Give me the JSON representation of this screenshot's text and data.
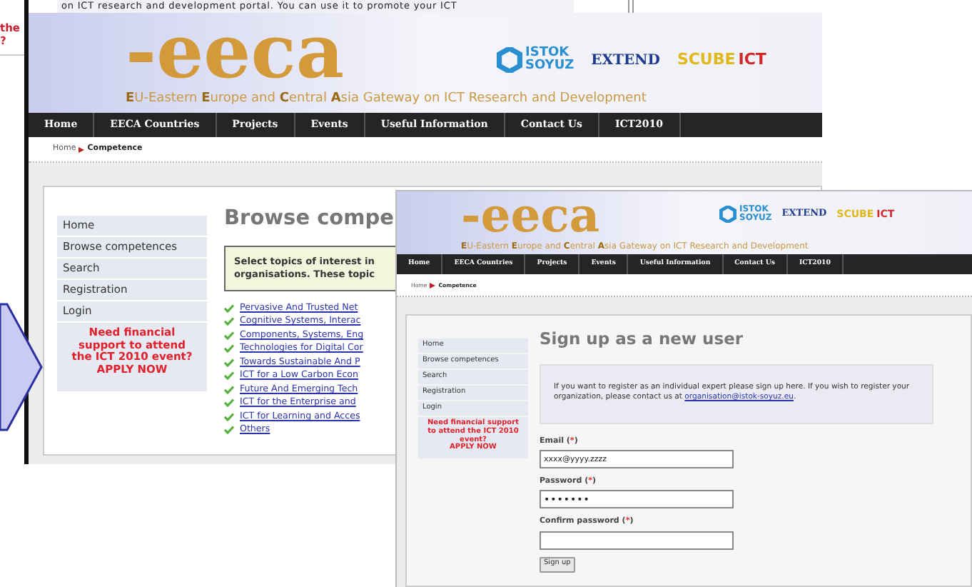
{
  "background_page": {
    "text_line": "on ICT research and development portal. You can use it to promote your ICT",
    "fragments": [
      "the",
      "?"
    ]
  },
  "middle_page": {
    "header": {
      "logo": "-eeca",
      "partners": [
        "ISTOK",
        "SOYUZ",
        "EXTEND",
        "SCUBE",
        "ICT"
      ],
      "tagline": "**E**U-Eastern **E**urope and **C**entral **A**sia Gateway on ICT Research and Development"
    },
    "nav": [
      "Home",
      "EECA Countries",
      "Projects",
      "Events",
      "Useful Information",
      "Contact Us",
      "ICT2010"
    ],
    "breadcrumb": [
      "Home",
      "Competence"
    ],
    "sidebar": {
      "items": [
        "Home",
        "Browse competences",
        "Search",
        "Registration",
        "Login"
      ],
      "promo": "Need financial support to attend the ICT 2010 event?",
      "promo_link": "APPLY NOW"
    },
    "title": "Browse compe",
    "intro_lines": [
      "Select topics of interest in",
      "organisations. These topic"
    ],
    "topics": [
      "Pervasive And Trusted Net",
      "Cognitive Systems, Interac",
      "Components, Systems, Eng",
      "Technologies for Digital Cor",
      "Towards Sustainable And P",
      "ICT for a Low Carbon Econ",
      "Future And Emerging Tech",
      "ICT for the Enterprise and",
      "ICT for Learning and Acces",
      "Others"
    ]
  },
  "front_page": {
    "header": {
      "logo": "-eeca",
      "partners": [
        "ISTOK",
        "SOYUZ",
        "EXTEND",
        "SCUBE",
        "ICT"
      ],
      "tagline": "**E**U-Eastern **E**urope and **C**entral **A**sia Gateway on ICT Research and Development"
    },
    "nav": [
      "Home",
      "EECA Countries",
      "Projects",
      "Events",
      "Useful Information",
      "Contact Us",
      "ICT2010"
    ],
    "breadcrumb": [
      "Home",
      "Competence"
    ],
    "sidebar": {
      "items": [
        "Home",
        "Browse competences",
        "Search",
        "Registration",
        "Login"
      ],
      "promo": "Need financial support to attend the ICT 2010 event?",
      "promo_link": "APPLY NOW"
    },
    "title": "Sign up as a new user",
    "info": {
      "text": "If you want to register as an individual expert please sign up here. If you wish to register your organization, please contact us at",
      "link": "organisation@istok-soyuz.eu",
      "after": "."
    },
    "fields": [
      {
        "label": "Email",
        "mark_open": "(",
        "mark": "*",
        "mark_close": ")",
        "value": "xxxx@yyyy.zzzz",
        "kind": "text"
      },
      {
        "label": "Password",
        "mark_open": "(",
        "mark": "*",
        "mark_close": ")",
        "value": "•••••••",
        "kind": "password"
      },
      {
        "label": "Confirm password",
        "mark_open": "(",
        "mark": "*",
        "mark_close": ")",
        "kind": "password"
      }
    ],
    "button": "Sign up"
  }
}
